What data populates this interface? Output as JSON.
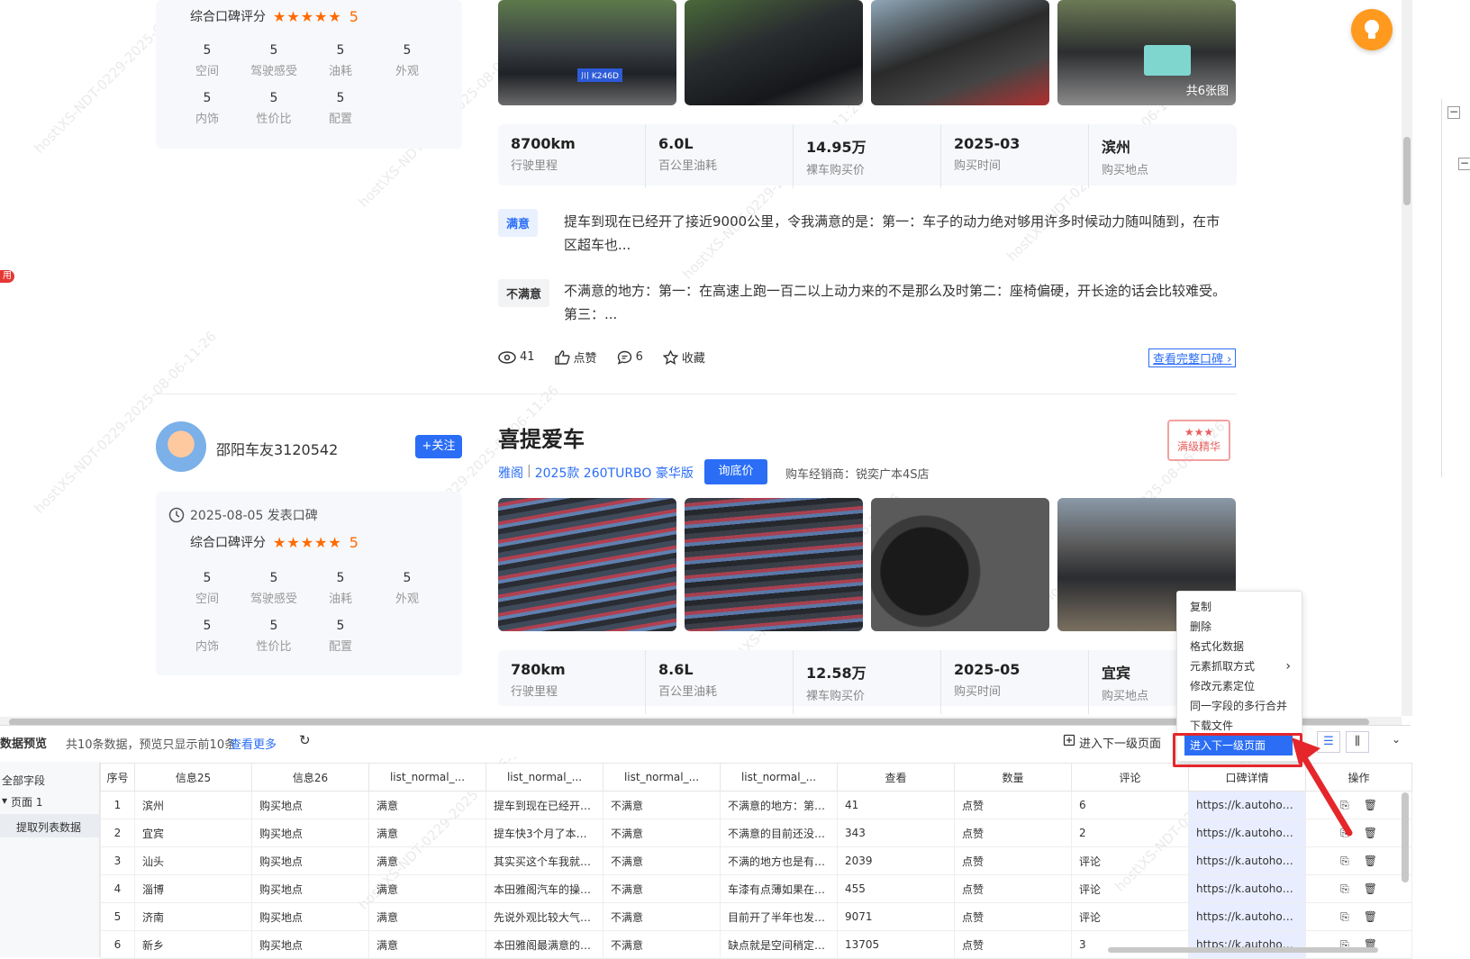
{
  "review1": {
    "rating_label": "综合口碑评分",
    "stars": "★★★★★",
    "score": "5",
    "scores": [
      {
        "value": "5",
        "label": "空间"
      },
      {
        "value": "5",
        "label": "驾驶感受"
      },
      {
        "value": "5",
        "label": "油耗"
      },
      {
        "value": "5",
        "label": "外观"
      },
      {
        "value": "5",
        "label": "内饰"
      },
      {
        "value": "5",
        "label": "性价比"
      },
      {
        "value": "5",
        "label": "配置"
      }
    ],
    "photo_count": "共6张图",
    "plate": "川 K246D",
    "stats": [
      {
        "value": "8700km",
        "label": "行驶里程"
      },
      {
        "value": "6.0L",
        "label": "百公里油耗"
      },
      {
        "value": "14.95万",
        "label": "裸车购买价"
      },
      {
        "value": "2025-03",
        "label": "购买时间"
      },
      {
        "value": "滨州",
        "label": "购买地点"
      }
    ],
    "satisfied_tag": "满意",
    "satisfied_text": "提车到现在已经开了接近9000公里，令我满意的是：第一：车子的动力绝对够用许多时候动力随叫随到，在市区超车也...",
    "unsatisfied_tag": "不满意",
    "unsatisfied_text": "不满意的地方：第一：在高速上跑一百二以上动力来的不是那么及时第二：座椅偏硬，开长途的话会比较难受。第三：...",
    "views": "41",
    "like": "点赞",
    "comments": "6",
    "favorite": "收藏",
    "full_link": "查看完整口碑"
  },
  "review2": {
    "username": "邵阳车友3120542",
    "follow": "+关注",
    "date": "2025-08-05 发表口碑",
    "rating_label": "综合口碑评分",
    "stars": "★★★★★",
    "score": "5",
    "scores": [
      {
        "value": "5",
        "label": "空间"
      },
      {
        "value": "5",
        "label": "驾驶感受"
      },
      {
        "value": "5",
        "label": "油耗"
      },
      {
        "value": "5",
        "label": "外观"
      },
      {
        "value": "5",
        "label": "内饰"
      },
      {
        "value": "5",
        "label": "性价比"
      },
      {
        "value": "5",
        "label": "配置"
      }
    ],
    "title": "喜提爱车",
    "model_link": "雅阁",
    "model_sep": "|",
    "model_version": "2025款 260TURBO 豪华版",
    "inquiry": "询底价",
    "dealer": "购车经销商：锐奕广本4S店",
    "badge": "满级精华",
    "badge_stars": "★★★",
    "stats": [
      {
        "value": "780km",
        "label": "行驶里程"
      },
      {
        "value": "8.6L",
        "label": "百公里油耗"
      },
      {
        "value": "12.58万",
        "label": "裸车购买价"
      },
      {
        "value": "2025-05",
        "label": "购买时间"
      },
      {
        "value": "宜宾",
        "label": "购买地点"
      }
    ]
  },
  "left_tag": "用",
  "context_menu": [
    "复制",
    "删除",
    "格式化数据",
    "元素抓取方式",
    "修改元素定位",
    "同一字段的多行合并",
    "下载文件",
    "进入下一级页面"
  ],
  "preview": {
    "title": "数据预览",
    "info": "共10条数据，预览只显示前10条",
    "more": "查看更多",
    "next_level": "进入下一级页面",
    "tree": {
      "all": "全部字段",
      "page": "页面 1",
      "list": "提取列表数据"
    },
    "columns": [
      "序号",
      "信息25",
      "信息26",
      "list_normal_...",
      "list_normal_...",
      "list_normal_...",
      "list_normal_...",
      "查看",
      "数量",
      "评论",
      "口碑详情",
      "操作"
    ],
    "rows": [
      [
        "1",
        "滨州",
        "购买地点",
        "满意",
        "提车到现在已经开了...",
        "不满意",
        "不满意的地方：第一...",
        "41",
        "点赞",
        "6",
        "https://k.autohome.c..."
      ],
      [
        "2",
        "宜宾",
        "购买地点",
        "满意",
        "提车快3个月了本来...",
        "不满意",
        "不满意的目前还没有...",
        "343",
        "点赞",
        "2",
        "https://k.autohome.c..."
      ],
      [
        "3",
        "汕头",
        "购买地点",
        "满意",
        "其实买这个车我就是...",
        "不满意",
        "不满的地方也是有，...",
        "2039",
        "点赞",
        "评论",
        "https://k.autohome.c..."
      ],
      [
        "4",
        "淄博",
        "购买地点",
        "满意",
        "本田雅阁汽车的操作...",
        "不满意",
        "车漆有点薄如果在能...",
        "455",
        "点赞",
        "评论",
        "https://k.autohome.c..."
      ],
      [
        "5",
        "济南",
        "购买地点",
        "满意",
        "先说外观比较大气，...",
        "不满意",
        "目前开了半年也发现...",
        "9071",
        "点赞",
        "评论",
        "https://k.autohome.c..."
      ],
      [
        "6",
        "新乡",
        "购买地点",
        "满意",
        "本田雅阁最满意的还...",
        "不满意",
        "缺点就是空间稍定有...",
        "13705",
        "点赞",
        "3",
        "https://k.autohome.c..."
      ]
    ]
  },
  "watermark": "host\\XS-NDT-0229-2025-08-06-11:26",
  "colors": {
    "accent": "#2b6ef5",
    "star": "#ff6a00",
    "highlight_border": "#e5262b"
  }
}
